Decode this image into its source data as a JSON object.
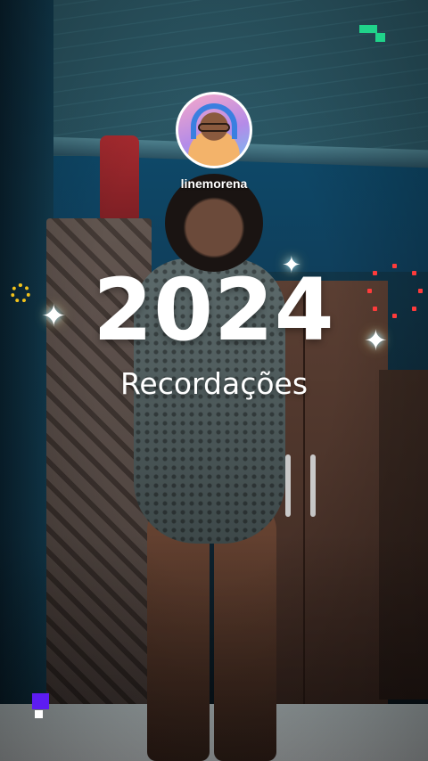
{
  "story": {
    "username": "linemorena",
    "year": "2024",
    "subtitle": "Recordações"
  },
  "icons": {
    "avatar": "profile-avatar",
    "sparkles": [
      "sparkle-icon",
      "sparkle-icon",
      "sparkle-icon"
    ],
    "decorations": [
      "green-pixel-icon",
      "yellow-gear-icon",
      "red-dot-ring-icon",
      "purple-pixel-icon"
    ]
  },
  "colors": {
    "accent_green": "#20d38a",
    "accent_yellow": "#f2c21b",
    "accent_red": "#ff3b3b",
    "accent_purple": "#5d1cf2"
  }
}
